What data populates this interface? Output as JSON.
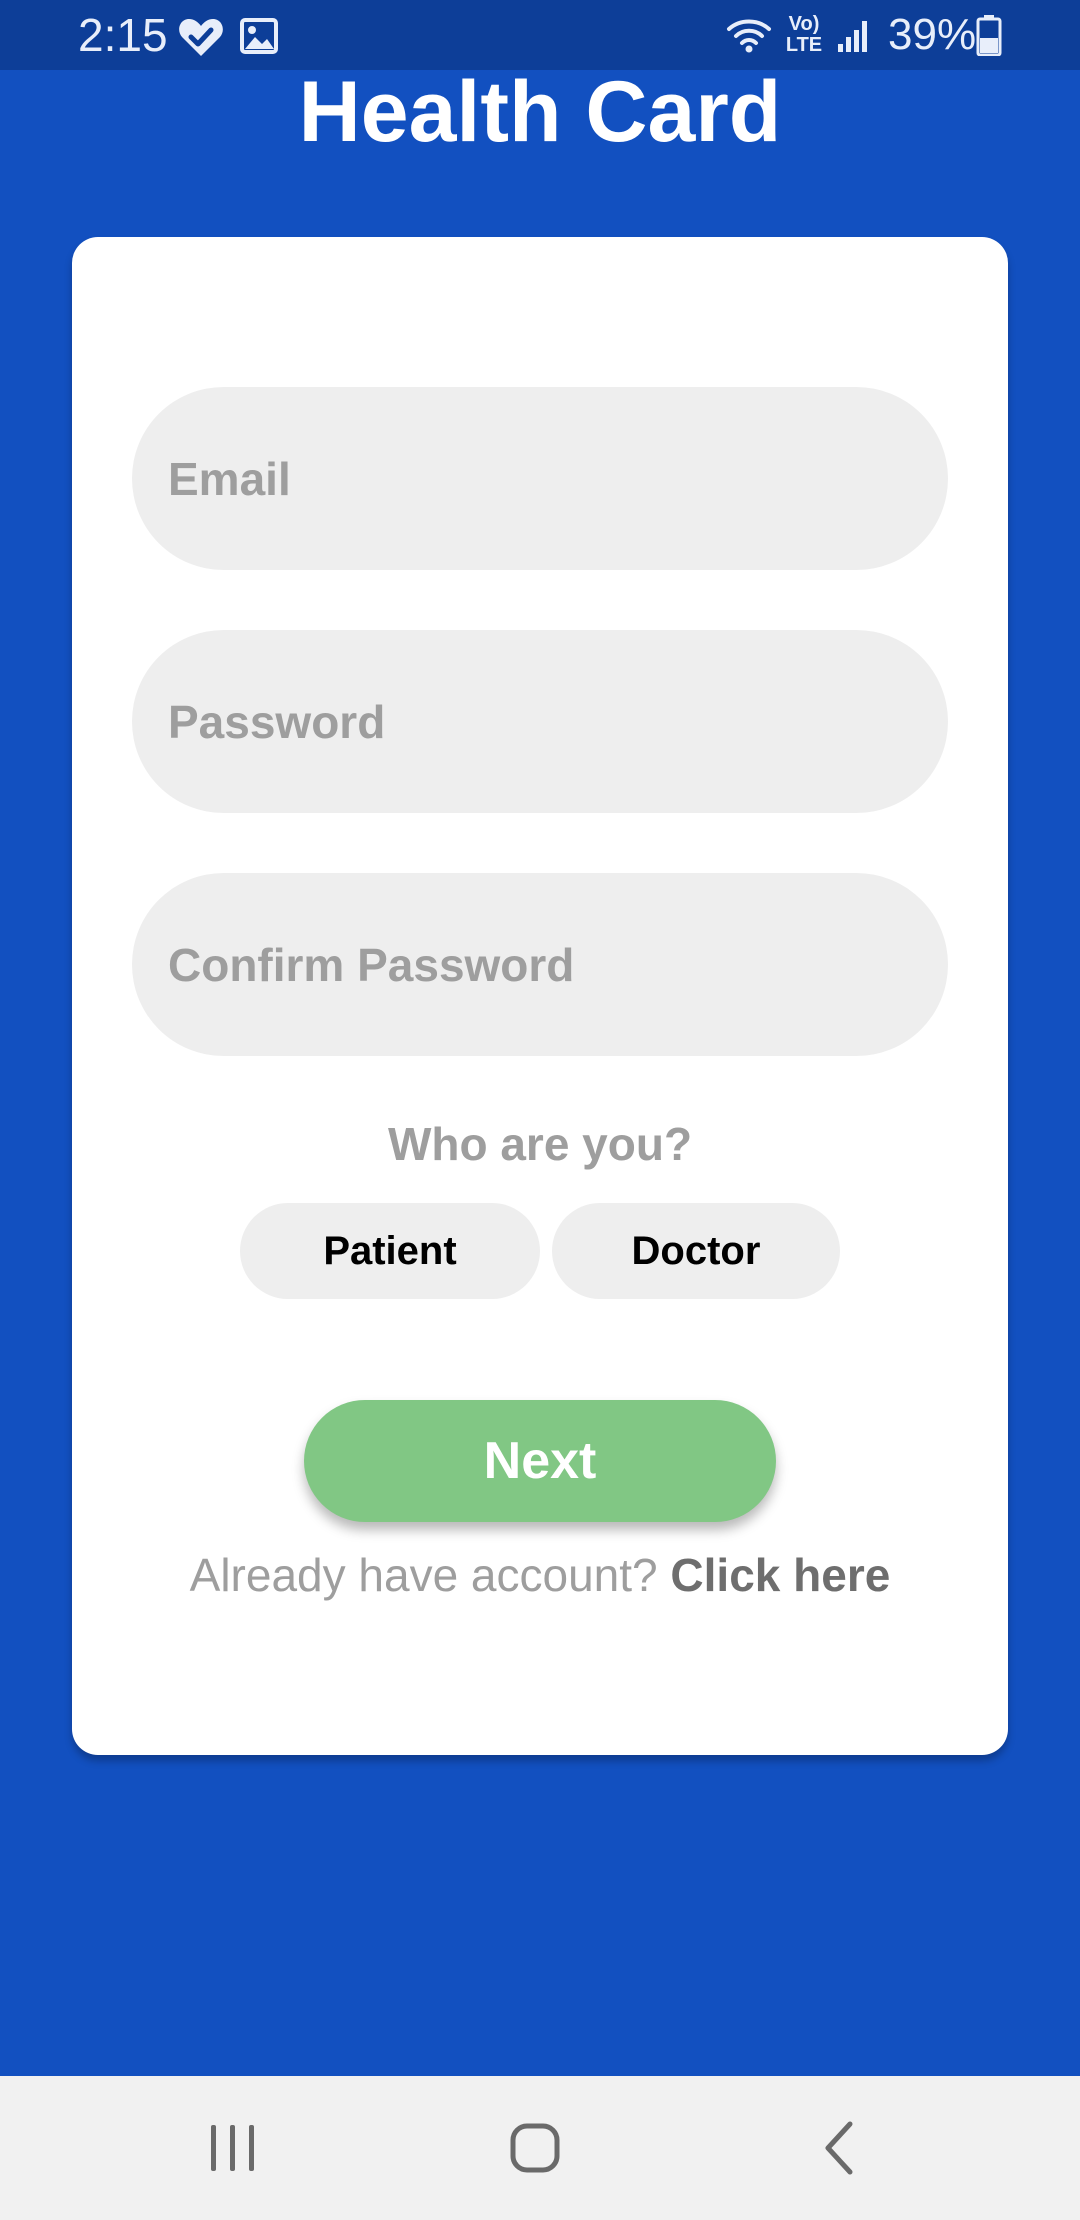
{
  "status_bar": {
    "time": "2:15",
    "battery": "39%",
    "icons": [
      "heart-check-icon",
      "image-icon",
      "wifi-icon",
      "volte-icon",
      "signal-icon",
      "battery-icon"
    ],
    "volte_line1": "Vo)",
    "volte_line2": "LTE"
  },
  "app": {
    "title": "Health Card"
  },
  "form": {
    "email_placeholder": "Email",
    "password_placeholder": "Password",
    "confirm_password_placeholder": "Confirm Password",
    "who_label": "Who are you?",
    "roles": [
      "Patient",
      "Doctor"
    ],
    "next_label": "Next",
    "login_prompt": "Already have account?",
    "login_link": "Click here"
  },
  "nav_bar": {
    "buttons": [
      "recents-icon",
      "home-icon",
      "back-icon"
    ]
  },
  "colors": {
    "background": "#1250C0",
    "status_bar": "#0D3E98",
    "card": "#FFFFFF",
    "field": "#EEEEEE",
    "next_button": "#81C784",
    "placeholder_text": "#9E9E9E"
  }
}
